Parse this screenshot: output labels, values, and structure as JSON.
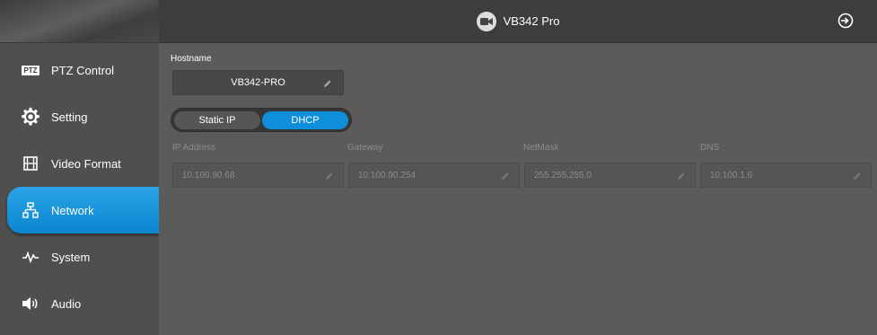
{
  "header": {
    "title": "VB342 Pro"
  },
  "sidebar": {
    "items": [
      {
        "label": "PTZ Control",
        "icon": "ptz-icon",
        "badge": "PTZ"
      },
      {
        "label": "Setting",
        "icon": "gear-icon"
      },
      {
        "label": "Video Format",
        "icon": "film-icon"
      },
      {
        "label": "Network",
        "icon": "network-icon",
        "active": true
      },
      {
        "label": "System",
        "icon": "pulse-icon"
      },
      {
        "label": "Audio",
        "icon": "speaker-icon"
      }
    ]
  },
  "network": {
    "hostname_label": "Hostname",
    "hostname_value": "VB342-PRO",
    "mode_static": "Static IP",
    "mode_dhcp": "DHCP",
    "selected_mode": "DHCP",
    "ip_label": "IP Address",
    "ip_value": "10.100.90.68",
    "gateway_label": "Gateway",
    "gateway_value": "10.100.90.254",
    "netmask_label": "NetMask",
    "netmask_value": "255.255.255.0",
    "dns_label": "DNS",
    "dns_value": "10.100.1.6"
  },
  "colors": {
    "accent": "#0f8fda",
    "sidebar": "#4f4f4f",
    "header": "#3d3d3d",
    "main": "#5b5b5b"
  }
}
